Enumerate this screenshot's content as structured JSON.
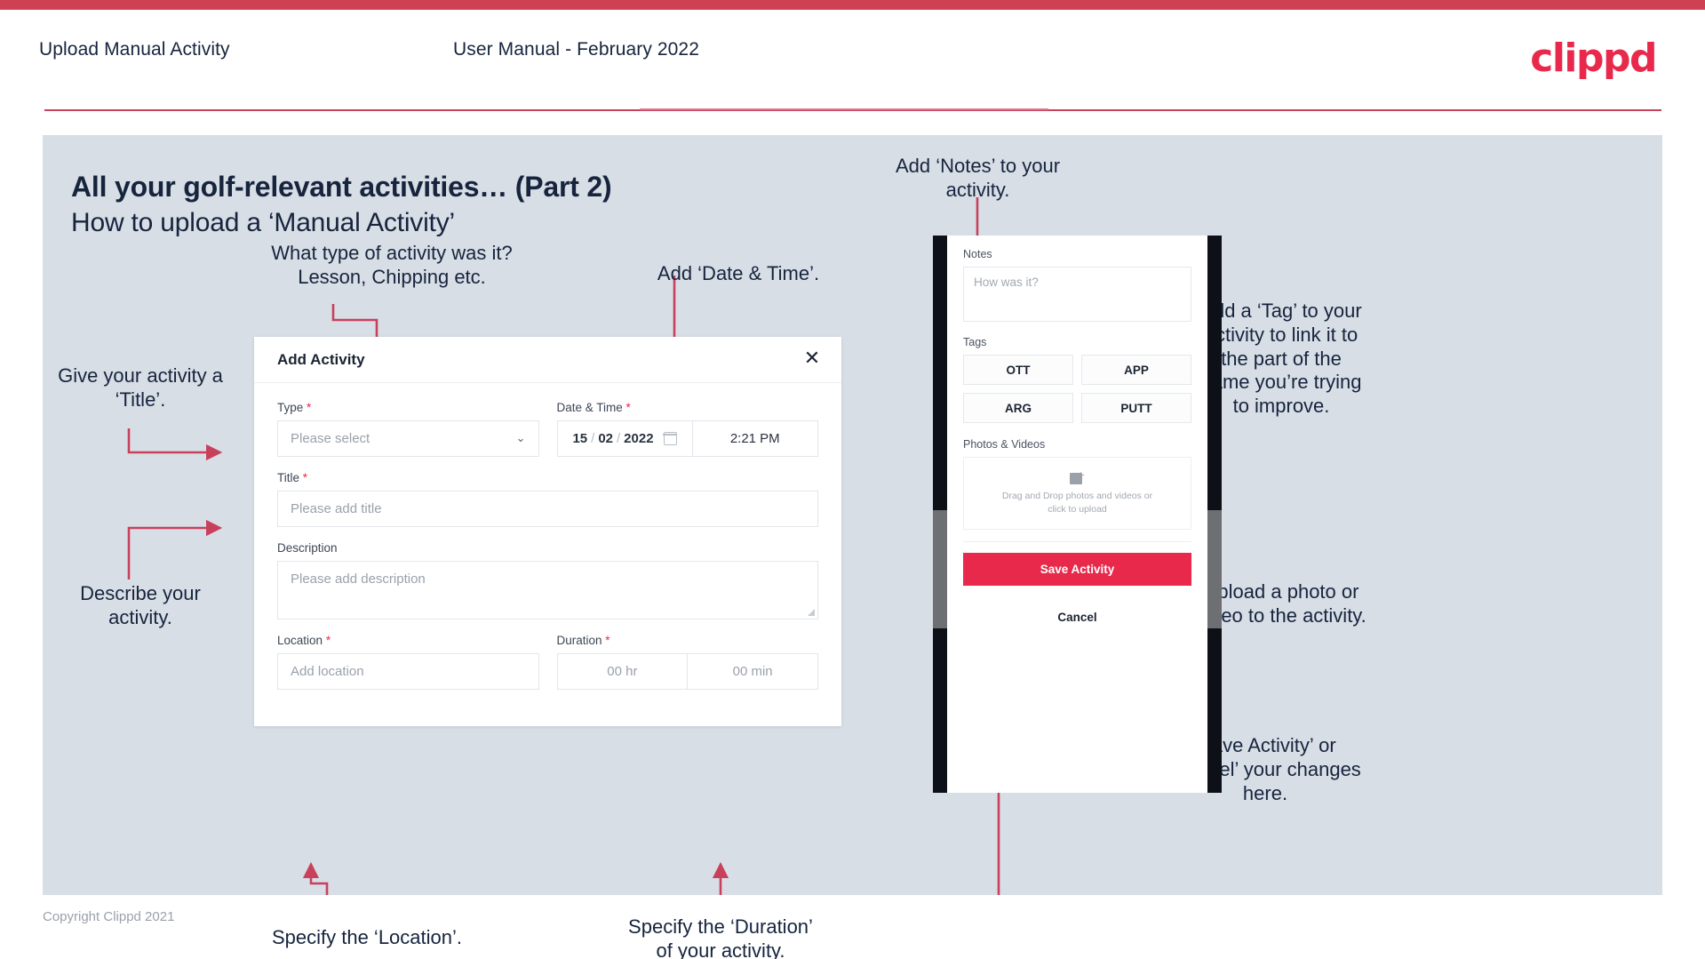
{
  "header": {
    "title": "Upload Manual Activity",
    "subtitle": "User Manual - February 2022",
    "logo": "clippd"
  },
  "slide": {
    "title": "All your golf-relevant activities… (Part 2)",
    "subtitle": "How to upload a ‘Manual Activity’"
  },
  "annotations": {
    "type": "What type of activity was it?\nLesson, Chipping etc.",
    "datetime": "Add ‘Date & Time’.",
    "title_field": "Give your activity a\n‘Title’.",
    "description": "Describe your\nactivity.",
    "location": "Specify the ‘Location’.",
    "duration": "Specify the ‘Duration’\nof your activity.",
    "notes": "Add ‘Notes’ to your\nactivity.",
    "tags": "Add a ‘Tag’ to your\nactivity to link it to\nthe part of the\ngame you’re trying\nto improve.",
    "upload": "Upload a photo or\nvideo to the activity.",
    "save_cancel": "‘Save Activity’ or\n‘Cancel’ your changes\nhere."
  },
  "dialog": {
    "title": "Add Activity",
    "close_icon": "close-icon",
    "fields": {
      "type_label": "Type",
      "type_value": "Please select",
      "datetime_label": "Date & Time",
      "date_day": "15",
      "date_month": "02",
      "date_year": "2022",
      "date_sep": "/",
      "time_value": "2:21 PM",
      "title_label": "Title",
      "title_placeholder": "Please add title",
      "description_label": "Description",
      "description_placeholder": "Please add description",
      "location_label": "Location",
      "location_placeholder": "Add location",
      "duration_label": "Duration",
      "duration_hr": "00 hr",
      "duration_min": "00 min",
      "required_mark": "*"
    }
  },
  "phone": {
    "notes_label": "Notes",
    "notes_placeholder": "How was it?",
    "tags_label": "Tags",
    "tags": [
      "OTT",
      "APP",
      "ARG",
      "PUTT"
    ],
    "photos_label": "Photos & Videos",
    "upload_text": "Drag and Drop photos and videos or click to upload",
    "save_label": "Save Activity",
    "cancel_label": "Cancel"
  },
  "footer": {
    "copyright": "Copyright Clippd 2021"
  },
  "colors": {
    "accent": "#e8294b",
    "bar": "#cf4055",
    "arrow": "#c8415c",
    "slide_bg": "#d8dee6",
    "text_dark": "#16243d"
  }
}
